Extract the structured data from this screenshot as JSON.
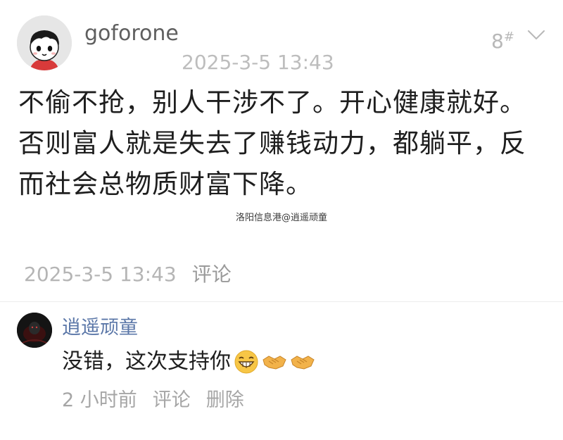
{
  "post": {
    "username": "goforone",
    "timestamp": "2025-3-5 13:43",
    "floor_number": "8",
    "floor_mark": "#",
    "text": "不偷不抢，别人干涉不了。开心健康就好。否则富人就是失去了赚钱动力，都躺平，反而社会总物质财富下降。",
    "watermark": "洛阳信息港@逍遥顽童"
  },
  "meta": {
    "timestamp": "2025-3-5 13:43",
    "comment_label": "评论"
  },
  "reply": {
    "author": "逍遥顽童",
    "text": "没错，这次支持你",
    "emojis": [
      "grin-icon",
      "handshake-icon",
      "handshake-icon"
    ],
    "relative_time": "2 小时前",
    "comment_label": "评论",
    "delete_label": "删除"
  },
  "colors": {
    "username": "#5f5f5f",
    "timestamp": "#bdbdbd",
    "body_text": "#1e1e1e",
    "reply_author": "#5b77a8",
    "meta_text": "#a6a6a6"
  }
}
